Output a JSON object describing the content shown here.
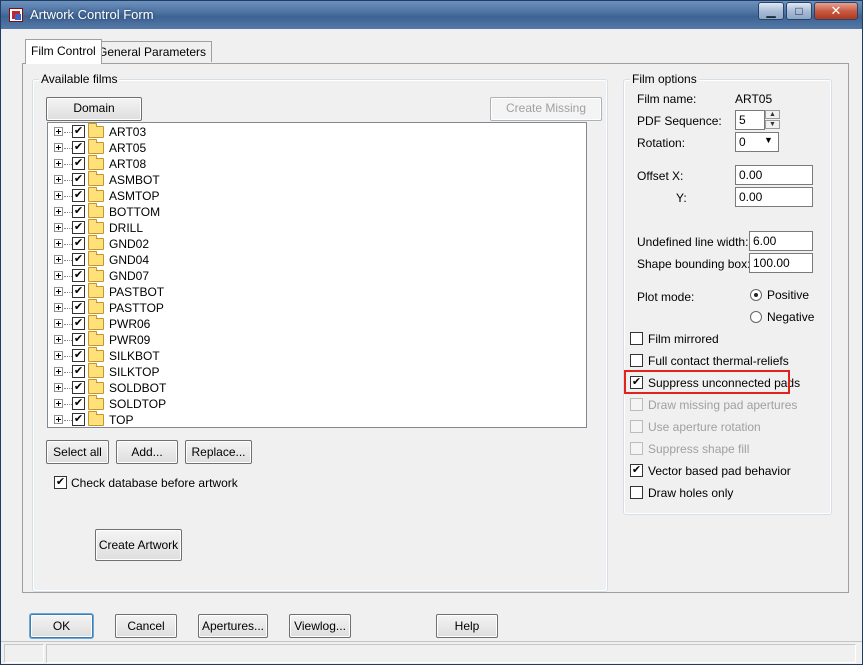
{
  "window": {
    "title": "Artwork Control Form",
    "controls": {
      "minimize": "▁",
      "maximize": "□",
      "close": "✕"
    }
  },
  "tabs": [
    {
      "label": "Film Control",
      "active": true
    },
    {
      "label": "General Parameters",
      "active": false
    }
  ],
  "available_films": {
    "group_label": "Available films",
    "domain_selection": "Domain Selection",
    "create_missing": "Create Missing Films",
    "films": [
      {
        "name": "ART03",
        "checked": true
      },
      {
        "name": "ART05",
        "checked": true
      },
      {
        "name": "ART08",
        "checked": true
      },
      {
        "name": "ASMBOT",
        "checked": true
      },
      {
        "name": "ASMTOP",
        "checked": true
      },
      {
        "name": "BOTTOM",
        "checked": true
      },
      {
        "name": "DRILL",
        "checked": true
      },
      {
        "name": "GND02",
        "checked": true
      },
      {
        "name": "GND04",
        "checked": true
      },
      {
        "name": "GND07",
        "checked": true
      },
      {
        "name": "PASTBOT",
        "checked": true
      },
      {
        "name": "PASTTOP",
        "checked": true
      },
      {
        "name": "PWR06",
        "checked": true
      },
      {
        "name": "PWR09",
        "checked": true
      },
      {
        "name": "SILKBOT",
        "checked": true
      },
      {
        "name": "SILKTOP",
        "checked": true
      },
      {
        "name": "SOLDBOT",
        "checked": true
      },
      {
        "name": "SOLDTOP",
        "checked": true
      },
      {
        "name": "TOP",
        "checked": true
      }
    ],
    "select_all": "Select all",
    "add": "Add...",
    "replace": "Replace...",
    "check_database": "Check database before artwork",
    "create_artwork": "Create Artwork"
  },
  "film_options": {
    "group_label": "Film options",
    "film_name_label": "Film name:",
    "film_name_value": "ART05",
    "pdf_sequence_label": "PDF Sequence:",
    "pdf_sequence_value": "5",
    "rotation_label": "Rotation:",
    "rotation_value": "0",
    "offset_label": "Offset",
    "x_label": "X:",
    "x_value": "0.00",
    "y_label": "Y:",
    "y_value": "0.00",
    "undefined_line_width_label": "Undefined line width:",
    "undefined_line_width_value": "6.00",
    "shape_bounding_box_label": "Shape bounding box:",
    "shape_bounding_box_value": "100.00",
    "plot_mode_label": "Plot mode:",
    "positive": "Positive",
    "negative": "Negative",
    "film_mirrored": "Film mirrored",
    "full_contact": "Full contact thermal-reliefs",
    "suppress_unconnected": "Suppress unconnected pads",
    "draw_missing": "Draw missing pad apertures",
    "use_aperture_rotation": "Use aperture rotation",
    "suppress_shape_fill": "Suppress shape fill",
    "vector_based": "Vector based pad behavior",
    "draw_holes_only": "Draw holes only"
  },
  "footer": {
    "ok": "OK",
    "cancel": "Cancel",
    "apertures": "Apertures...",
    "viewlog": "Viewlog...",
    "help": "Help"
  },
  "checkmark": "✔",
  "colors": {
    "highlight": "#e2231a",
    "folder": "#ffe07a",
    "titlebar": "#4a6f9f"
  }
}
